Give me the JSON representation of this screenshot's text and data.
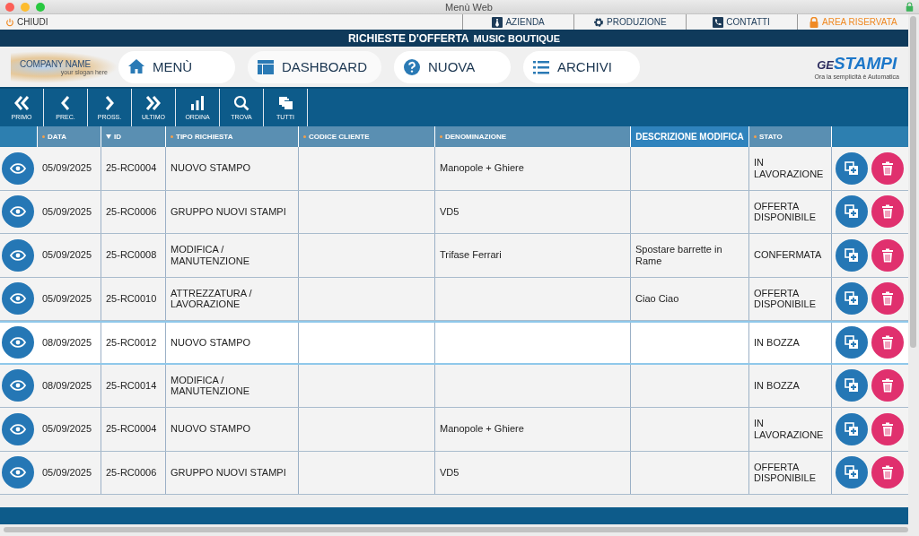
{
  "window": {
    "title": "Menù Web"
  },
  "top_menu": {
    "close": "CHIUDI",
    "items": [
      {
        "label": "AZIENDA",
        "accent": false
      },
      {
        "label": "PRODUZIONE",
        "accent": false
      },
      {
        "label": "CONTATTI",
        "accent": false
      },
      {
        "label": "AREA RISERVATA",
        "accent": true
      }
    ]
  },
  "banner": {
    "title": "RICHIESTE D'OFFERTA",
    "subtitle": "MUSIC BOUTIQUE"
  },
  "company": {
    "name": "COMPANY NAME",
    "slogan": "your slogan here"
  },
  "nav": [
    {
      "label": "MENÙ"
    },
    {
      "label": "DASHBOARD"
    },
    {
      "label": "NUOVA"
    },
    {
      "label": "ARCHIVI"
    }
  ],
  "brand": {
    "prefix": "GE",
    "name": "STAMPI",
    "tagline": "Ora la semplicità è Automatica"
  },
  "toolbar": [
    {
      "label": "PRIMO"
    },
    {
      "label": "PREC."
    },
    {
      "label": "PROSS."
    },
    {
      "label": "ULTIMO"
    },
    {
      "label": "ORDINA"
    },
    {
      "label": "TROVA"
    },
    {
      "label": "TUTTI"
    }
  ],
  "table": {
    "columns": [
      {
        "label": "DATA",
        "sortable": true,
        "sorted": false
      },
      {
        "label": "ID",
        "sortable": true,
        "sorted": true
      },
      {
        "label": "TIPO RICHIESTA",
        "sortable": true,
        "sorted": false
      },
      {
        "label": "CODICE CLIENTE",
        "sortable": true,
        "sorted": false
      },
      {
        "label": "DENOMINAZIONE",
        "sortable": true,
        "sorted": false
      },
      {
        "label": "DESCRIZIONE MODIFICA",
        "sortable": false,
        "sorted": false
      },
      {
        "label": "STATO",
        "sortable": true,
        "sorted": false
      }
    ],
    "rows": [
      {
        "selected": false,
        "cells": [
          "05/09/2025",
          "25-RC0004",
          "NUOVO STAMPO",
          "",
          "Manopole + Ghiere",
          "",
          "IN\nLAVORAZIONE"
        ]
      },
      {
        "selected": false,
        "cells": [
          "05/09/2025",
          "25-RC0006",
          "GRUPPO NUOVI STAMPI",
          "",
          "VD5",
          "",
          "OFFERTA\nDISPONIBILE"
        ]
      },
      {
        "selected": false,
        "cells": [
          "05/09/2025",
          "25-RC0008",
          "MODIFICA /\nMANUTENZIONE",
          "",
          "Trifase Ferrari",
          "Spostare barrette in\nRame",
          "CONFERMATA"
        ]
      },
      {
        "selected": false,
        "cells": [
          "05/09/2025",
          "25-RC0010",
          "ATTREZZATURA /\nLAVORAZIONE",
          "",
          "",
          "Ciao Ciao",
          "OFFERTA\nDISPONIBILE"
        ]
      },
      {
        "selected": true,
        "cells": [
          "08/09/2025",
          "25-RC0012",
          "NUOVO STAMPO",
          "",
          "",
          "",
          "IN BOZZA"
        ]
      },
      {
        "selected": false,
        "cells": [
          "08/09/2025",
          "25-RC0014",
          "MODIFICA /\nMANUTENZIONE",
          "",
          "",
          "",
          "IN BOZZA"
        ]
      },
      {
        "selected": false,
        "cells": [
          "05/09/2025",
          "25-RC0004",
          "NUOVO STAMPO",
          "",
          "Manopole + Ghiere",
          "",
          "IN\nLAVORAZIONE"
        ]
      },
      {
        "selected": false,
        "cells": [
          "05/09/2025",
          "25-RC0006",
          "GRUPPO NUOVI STAMPI",
          "",
          "VD5",
          "",
          "OFFERTA\nDISPONIBILE"
        ]
      }
    ]
  }
}
